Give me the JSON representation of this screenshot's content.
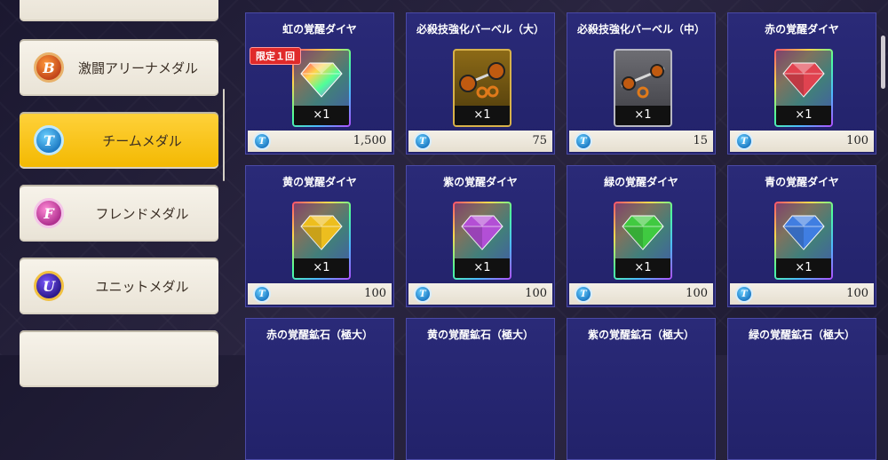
{
  "sidebar": {
    "items": [
      {
        "label": "",
        "medal": "",
        "partial": true
      },
      {
        "label": "激闘アリーナメダル",
        "medal": "B",
        "active": false
      },
      {
        "label": "チームメダル",
        "medal": "T",
        "active": true
      },
      {
        "label": "フレンドメダル",
        "medal": "F",
        "active": false
      },
      {
        "label": "ユニットメダル",
        "medal": "U",
        "active": false
      },
      {
        "label": "",
        "medal": "",
        "partial": true
      }
    ]
  },
  "currency_icon": "T",
  "items": [
    {
      "title": "虹の覚醒ダイヤ",
      "qty": "×1",
      "price": "1,500",
      "limit": "限定１回",
      "icon": "rainbow-diamond-icon",
      "frame": "rainbow",
      "gem_color": "#ff5ad0"
    },
    {
      "title": "必殺技強化バーベル（大）",
      "qty": "×1",
      "price": "75",
      "limit": "",
      "icon": "barbell-large-icon",
      "frame": "gold"
    },
    {
      "title": "必殺技強化バーベル（中）",
      "qty": "×1",
      "price": "15",
      "limit": "",
      "icon": "barbell-medium-icon",
      "frame": "silver"
    },
    {
      "title": "赤の覚醒ダイヤ",
      "qty": "×1",
      "price": "100",
      "limit": "",
      "icon": "red-diamond-icon",
      "frame": "rainbow",
      "gem_color": "#e8414f"
    },
    {
      "title": "黄の覚醒ダイヤ",
      "qty": "×1",
      "price": "100",
      "limit": "",
      "icon": "yellow-diamond-icon",
      "frame": "rainbow",
      "gem_color": "#f5c21b"
    },
    {
      "title": "紫の覚醒ダイヤ",
      "qty": "×1",
      "price": "100",
      "limit": "",
      "icon": "purple-diamond-icon",
      "frame": "rainbow",
      "gem_color": "#b84ddc"
    },
    {
      "title": "緑の覚醒ダイヤ",
      "qty": "×1",
      "price": "100",
      "limit": "",
      "icon": "green-diamond-icon",
      "frame": "rainbow",
      "gem_color": "#3fcf3f"
    },
    {
      "title": "青の覚醒ダイヤ",
      "qty": "×1",
      "price": "100",
      "limit": "",
      "icon": "blue-diamond-icon",
      "frame": "rainbow",
      "gem_color": "#3f7fe8"
    },
    {
      "title": "赤の覚醒鉱石（極大）",
      "qty": "",
      "price": "",
      "limit": "",
      "icon": "",
      "frame": ""
    },
    {
      "title": "黄の覚醒鉱石（極大）",
      "qty": "",
      "price": "",
      "limit": "",
      "icon": "",
      "frame": ""
    },
    {
      "title": "紫の覚醒鉱石（極大）",
      "qty": "",
      "price": "",
      "limit": "",
      "icon": "",
      "frame": ""
    },
    {
      "title": "緑の覚醒鉱石（極大）",
      "qty": "",
      "price": "",
      "limit": "",
      "icon": "",
      "frame": ""
    }
  ]
}
